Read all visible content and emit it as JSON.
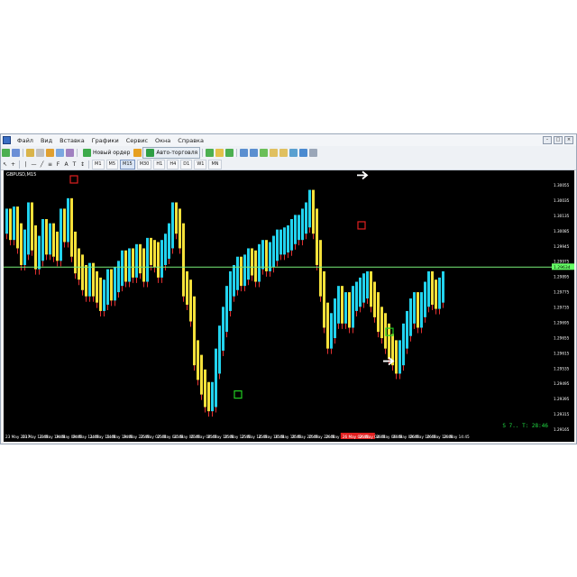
{
  "menu": {
    "items": [
      "Файл",
      "Вид",
      "Вставка",
      "Графики",
      "Сервис",
      "Окна",
      "Справка"
    ]
  },
  "toolbar": {
    "new_order_label": "Новый ордер",
    "autotrading_label": "Авто-торговля"
  },
  "timeframes": [
    "M1",
    "M5",
    "M15",
    "M30",
    "H1",
    "H4",
    "D1",
    "W1",
    "MN"
  ],
  "chart": {
    "symbol_label": "GBPUSD,M15",
    "timer": "S  7..  T:  28:46",
    "colors": {
      "background": "#000000",
      "bull": "#22d3ee",
      "bear": "#f5e13a",
      "wick_down": "#e03030",
      "horizontal_line": "#7bf07b",
      "price_tag": "#66ff66",
      "red_marker": "#e02020",
      "green_marker": "#22cc22",
      "arrow": "#ffffff",
      "highlight_date": "#e02020"
    },
    "icons": [
      "arrow-right-icon",
      "square-marker-icon"
    ]
  },
  "chart_data": {
    "type": "line",
    "title": "",
    "xlabel": "",
    "ylabel": "",
    "ylim": [
      1.2885,
      1.3005
    ],
    "y_ticks": [
      "1.30055",
      "1.30035",
      "1.30135",
      "1.30085",
      "1.29945",
      "1.29975",
      "1.29895",
      "1.29775",
      "1.29735",
      "1.29695",
      "1.29655",
      "1.29615",
      "1.29535",
      "1.29495",
      "1.29395",
      "1.29315",
      "1.29165"
    ],
    "current_price_label": "1.29634",
    "x_ticks": [
      "23 May 2017",
      "23 May 13:45",
      "23 May 19:45",
      "24 May 09:45",
      "24 May 11:45",
      "24 May 15:45",
      "24 May 19:45",
      "24 May 23:45",
      "25 May 02:45",
      "25 May 04:45",
      "25 May 06:45",
      "25 May 08:45",
      "25 May 10:45",
      "25 May 12:45",
      "25 May 14:45",
      "25 May 16:45",
      "25 May 18:45",
      "25 May 20:45",
      "25 May 22:45",
      "26 May 00:45",
      "26 May 02:45",
      "26 May 04:45",
      "26 May 06:45",
      "26 May 08:45",
      "26 May 10:45",
      "26 May 12:45",
      "26 May 14:45"
    ],
    "highlight_tick_index": 20,
    "series": [
      {
        "x": [
          0,
          4,
          8,
          12,
          16,
          20,
          24,
          28,
          32,
          36,
          40,
          44,
          48,
          52,
          56,
          60,
          64,
          68,
          72,
          76,
          80,
          84,
          88,
          92,
          96,
          100,
          104,
          108,
          112,
          116,
          120,
          124,
          128,
          132,
          136,
          140,
          144,
          148,
          152,
          156,
          160,
          164,
          168,
          172,
          176,
          180,
          184,
          188,
          192,
          196,
          200,
          204,
          208,
          212,
          216,
          220,
          224,
          228,
          232,
          236,
          240,
          244,
          248,
          252,
          256,
          260,
          264,
          268,
          272,
          276,
          280,
          284,
          288,
          292,
          296,
          300,
          304,
          308,
          312,
          316,
          320,
          324,
          328,
          332,
          336,
          340,
          344,
          348,
          352,
          356,
          360,
          364,
          368,
          372,
          376,
          380,
          384,
          388,
          392,
          396,
          400,
          404,
          408,
          412,
          416,
          420,
          424,
          428,
          432,
          436,
          440,
          444,
          448,
          452,
          456,
          460,
          464,
          468,
          472,
          476,
          480,
          484
        ],
        "values": [
          1.2985,
          1.2982,
          1.2986,
          1.2978,
          1.297,
          1.2975,
          1.2988,
          1.2977,
          1.2968,
          1.2972,
          1.298,
          1.2975,
          1.2978,
          1.2974,
          1.2972,
          1.2985,
          1.2981,
          1.299,
          1.2974,
          1.2966,
          1.2963,
          1.2958,
          1.2955,
          1.2959,
          1.2955,
          1.2952,
          1.2948,
          1.2951,
          1.2956,
          1.2953,
          1.2957,
          1.296,
          1.2965,
          1.2962,
          1.2966,
          1.2964,
          1.2968,
          1.2966,
          1.2962,
          1.2971,
          1.297,
          1.2969,
          1.2964,
          1.297,
          1.2973,
          1.2978,
          1.2988,
          1.2985,
          1.2978,
          1.2955,
          1.2951,
          1.2943,
          1.2922,
          1.2915,
          1.2908,
          1.2902,
          1.29,
          1.2902,
          1.2918,
          1.2929,
          1.2938,
          1.2948,
          1.2955,
          1.2958,
          1.2962,
          1.296,
          1.2963,
          1.2966,
          1.2965,
          1.2962,
          1.2968,
          1.297,
          1.2967,
          1.2969,
          1.2972,
          1.2975,
          1.2975,
          1.2976,
          1.2977,
          1.298,
          1.2982,
          1.2982,
          1.2985,
          1.2988,
          1.2994,
          1.2985,
          1.297,
          1.2955,
          1.294,
          1.293,
          1.2935,
          1.2942,
          1.2948,
          1.2942,
          1.2945,
          1.294,
          1.2948,
          1.295,
          1.2952,
          1.2954,
          1.2955,
          1.295,
          1.2945,
          1.2938,
          1.2935,
          1.293,
          1.2925,
          1.2922,
          1.2918,
          1.2922,
          1.293,
          1.2936,
          1.2942,
          1.2945,
          1.294,
          1.2945,
          1.295,
          1.2955,
          1.2951,
          1.2949,
          1.2952,
          1.2955
        ]
      }
    ],
    "annotations": {
      "horizontal_line": 1.2963,
      "red_markers": [
        {
          "x": 76,
          "y": 1.3005
        },
        {
          "x": 395,
          "y": 1.2983
        }
      ],
      "green_markers": [
        {
          "x": 258,
          "y": 1.2902
        },
        {
          "x": 426,
          "y": 1.2932
        }
      ],
      "white_arrows": [
        {
          "x": 78,
          "y": 1.3016
        },
        {
          "x": 396,
          "y": 1.3007
        },
        {
          "x": 425,
          "y": 1.2918
        }
      ]
    }
  }
}
